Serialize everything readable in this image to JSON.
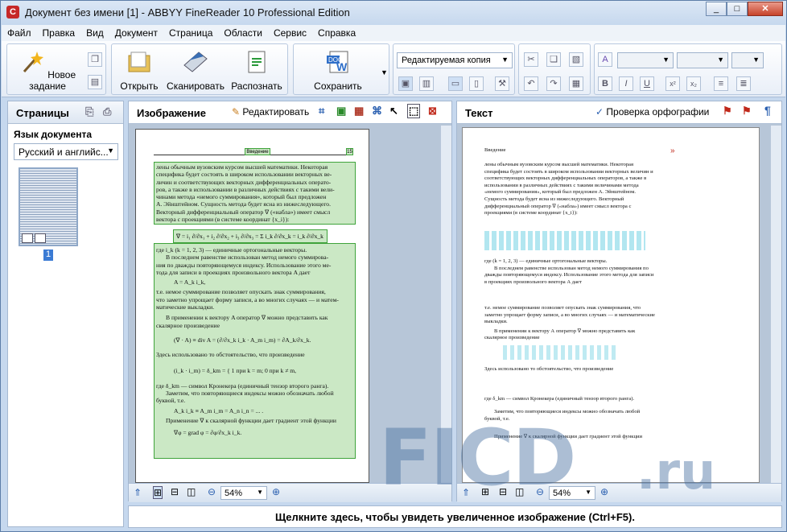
{
  "window": {
    "title": "Документ без имени [1] - ABBYY FineReader 10 Professional Edition",
    "app_icon_letter": "C"
  },
  "menu": [
    "Файл",
    "Правка",
    "Вид",
    "Документ",
    "Страница",
    "Области",
    "Сервис",
    "Справка"
  ],
  "toolbar": {
    "new_task": "Новое задание",
    "open": "Открыть",
    "scan": "Сканировать",
    "recognize": "Распознать",
    "save": "Сохранить",
    "format_select": "Редактируемая копия"
  },
  "pages_panel": {
    "title": "Страницы",
    "lang_label": "Язык документа",
    "lang_value": "Русский и английс...",
    "thumb_number": "1"
  },
  "image_panel": {
    "title": "Изображение",
    "edit": "Редактировать",
    "zoom": "54%"
  },
  "text_panel": {
    "title": "Текст",
    "spellcheck": "Проверка орфографии",
    "zoom": "54%",
    "para_mark": "¶"
  },
  "status": "Щелкните здесь, чтобы увидеть увеличенное изображение (Ctrl+F5).",
  "watermark": {
    "left": "FICD",
    "right": ".ru"
  },
  "image_page": {
    "header": "Введение",
    "page_no": "15",
    "block1": [
      "лены обычным вузовским курсом высшей математики. Некоторая",
      "специфика будет состоять в широком использовании векторных ве-",
      "личин и соответствующих векторных дифференциальных операто-",
      "ров, а также в использовании в различных действиях с такими вели-",
      "чинами метода «немого суммирования», который был предложен",
      "А. Эйнштейном. Сущность метода будет ясна из нижеследующего.",
      "Векторный дифференциальный оператор ∇ («набла») имеет смысл",
      "вектора с проекциями (в системе координат {x_i}):"
    ],
    "formula1": "∇ = i₁ ∂/∂x₁ + i₂ ∂/∂x₂ + i₃ ∂/∂x₃ = Σ i_k ∂/∂x_k = i_k ∂/∂x_k",
    "block2": [
      "где i_k (k = 1, 2, 3) — единичные ортогональные векторы.",
      "В последнем равенстве использован метод немого суммирова-",
      "ния по дважды повторяющемуся индексу. Использование этого ме-",
      "тода для записи в проекциях произвольного вектора A дает",
      "A = A_k i_k,",
      "т.е. немое суммирование позволяет опускать знак суммирования,",
      "что заметно упрощает форму записи, а во многих случаях — и матем-",
      "матические выкладки.",
      "В применении к вектору A оператор ∇ можно представить как",
      "скалярное произведение",
      "(∇ · A) ≡ div A = (∂/∂x_k i_k · A_m i_m) = ∂A_k/∂x_k.",
      "Здесь использовано то обстоятельство, что произведение",
      "(i_k · i_m) = δ_km = { 1 при k = m; 0 при k ≠ m,",
      "где δ_km — символ Кронекера (единичный тензор второго ранга).",
      "Заметим, что повторяющиеся индексы можно обозначать любой",
      "буквой, т.е.",
      "A_k i_k ≡ A_m i_m = A_n i_n = ... .",
      "Применение ∇ к скалярной функции дает градиент этой функции",
      "∇φ = grad φ = ∂φ/∂x_k i_k."
    ]
  },
  "text_page": {
    "header": "Введение",
    "lines": [
      "лены обычным вузовским курсом высшей математики. Некоторая",
      "специфика будет состоять в широком использовании векторных величин и",
      "соответствующих векторных дифференциальных операторов, а также в",
      "использовании в различных действиях с такими величинами метода",
      "«немого суммирования», который был предложен А. Эйнштейном.",
      "Сущность метода будет ясна из нижеследующего. Векторный",
      "дифференциальный оператор ∇ («набла») имеет смысл вектора с",
      "проекциями (в системе координат {x_i}):"
    ],
    "lines2": [
      "где (k = 1, 2, 3) — единичные ортогональные векторы.",
      "В последнем равенстве использован метод немого суммирования по",
      "дважды повторяющемуся индексу. Использование этого метода для записи",
      "в проекциях произвольного вектора А дает"
    ],
    "lines3": [
      "т.е. немое суммирование позволяет опускать знак суммирования, что",
      "заметно упрощает форму записи, а во многих случаях — и математические",
      "выкладки.",
      "В применении к вектору А оператор ∇ можно представить как",
      "скалярное произведение"
    ],
    "lines4": [
      "Здесь использовано то обстоятельство, что произведение",
      "где δ_km — символ Кронекера (единичный тензор второго ранга).",
      "Заметим, что повторяющиеся индексы можно обозначать любой",
      "буквой, т.е.",
      "Применение ∇ к скалярной функции дает градиент этой функции"
    ]
  }
}
